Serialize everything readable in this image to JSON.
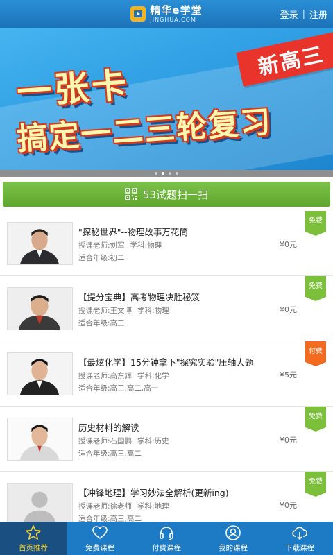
{
  "header": {
    "logo_cn": "精华e学堂",
    "logo_en": "JINGHUA.COM",
    "login": "登录",
    "separator": "|",
    "register": "注册"
  },
  "banner": {
    "line1": "一张卡",
    "line2": "搞定一二三轮复习",
    "tag": "新高三"
  },
  "scan_button": {
    "label": "53试题扫一扫"
  },
  "courses": [
    {
      "title": "\"探秘世界\"--物理故事万花筒",
      "teacher": "授课老师:刘军",
      "subject": "学科:物理",
      "grade": "适合年级:初二",
      "price": "¥0元",
      "badge": "免费",
      "badge_type": "free"
    },
    {
      "title": "【提分宝典】高考物理决胜秘笈",
      "teacher": "授课老师:王文博",
      "subject": "学科:物理",
      "grade": "适合年级:高三",
      "price": "¥0元",
      "badge": "免费",
      "badge_type": "free"
    },
    {
      "title": "【最炫化学】15分钟拿下\"探究实验\"压轴大题",
      "teacher": "授课老师:高东辉",
      "subject": "学科:化学",
      "grade": "适合年级:高三,高二,高一",
      "price": "¥5元",
      "badge": "付费",
      "badge_type": "paid"
    },
    {
      "title": "历史材料的解读",
      "teacher": "授课老师:石国鹏",
      "subject": "学科:历史",
      "grade": "适合年级:高三,高二",
      "price": "¥0元",
      "badge": "免费",
      "badge_type": "free"
    },
    {
      "title": "【冲锋地理】学习妙法全解析(更新ing)",
      "teacher": "授课老师:徐老师",
      "subject": "学科:地理",
      "grade": "适合年级:高三,高二",
      "price": "¥0元",
      "badge": "免费",
      "badge_type": "free"
    }
  ],
  "nav": [
    {
      "label": "首页推荐",
      "icon": "star-icon",
      "active": true
    },
    {
      "label": "免费课程",
      "icon": "heart-icon",
      "active": false
    },
    {
      "label": "付费课程",
      "icon": "headphones-icon",
      "active": false
    },
    {
      "label": "我的课程",
      "icon": "person-icon",
      "active": false
    },
    {
      "label": "下载课程",
      "icon": "cloud-download-icon",
      "active": false
    }
  ],
  "colors": {
    "header": "#1d72b8",
    "scan_green": "#6bb23a",
    "badge_free": "#7cbf3a",
    "badge_paid": "#f26b1f",
    "nav_active": "#1a4f82",
    "nav_active_text": "#f5d23a"
  }
}
